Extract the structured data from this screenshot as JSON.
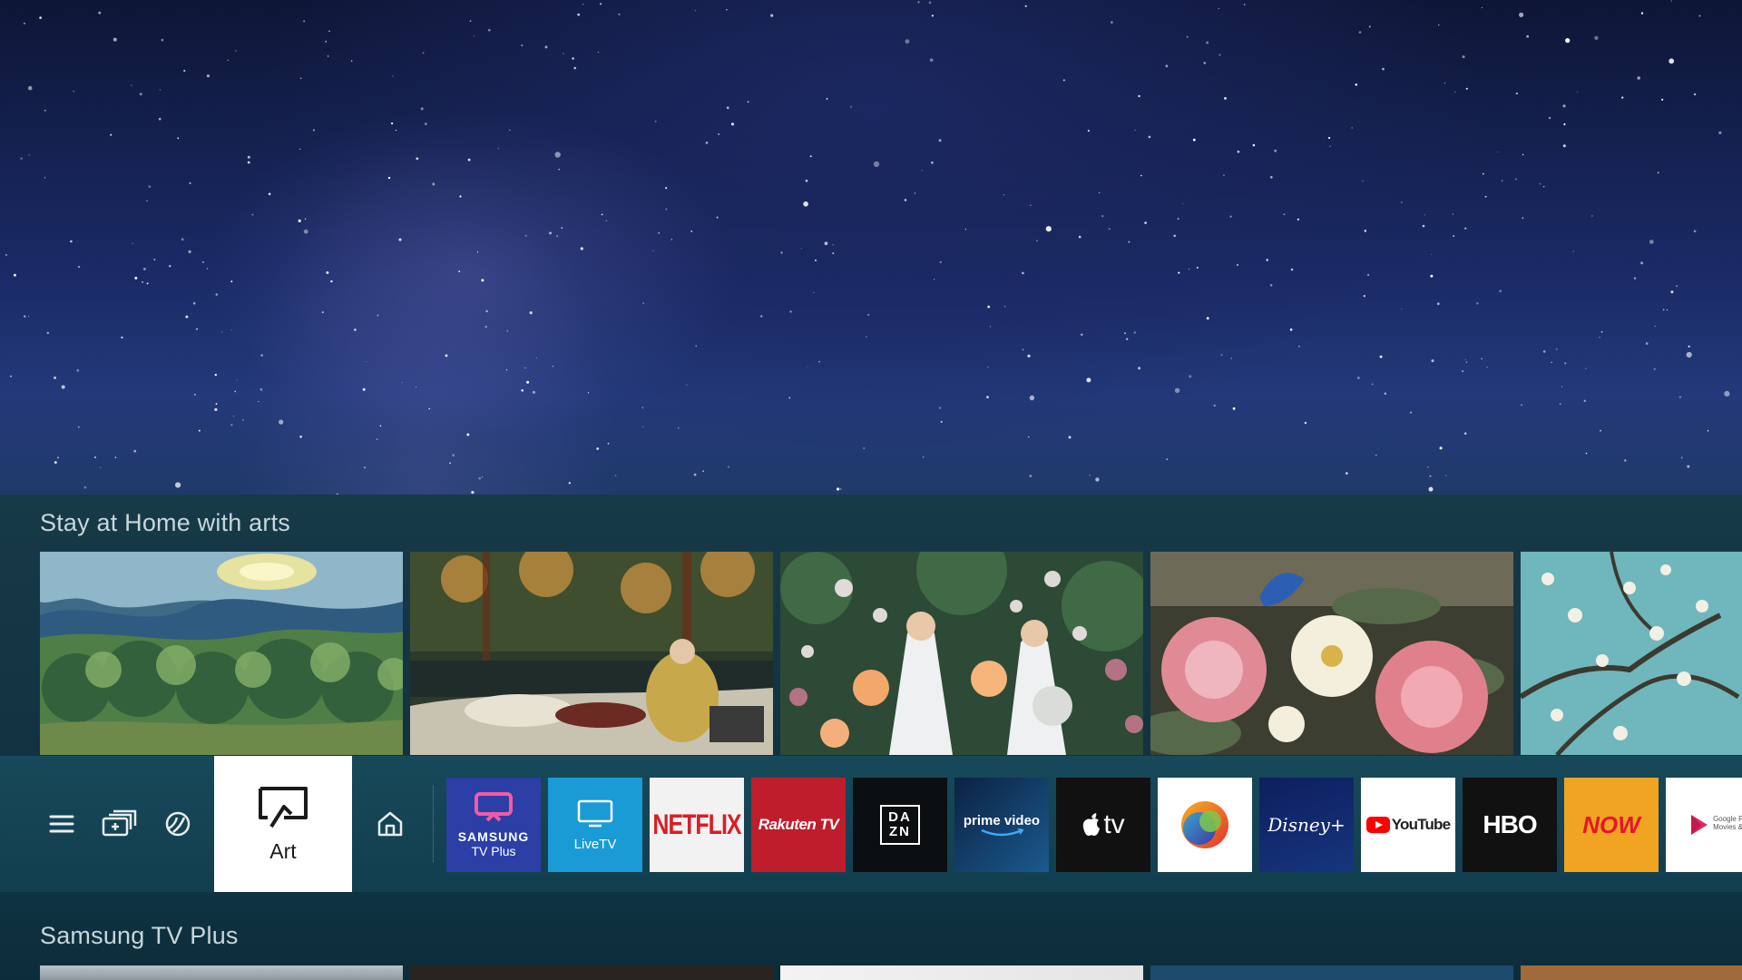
{
  "hero": {
    "caption": ""
  },
  "rows": [
    {
      "title": "Stay at Home with arts"
    },
    {
      "title": "Samsung TV Plus"
    }
  ],
  "art_tiles": [
    {
      "name": "olive-trees-painting"
    },
    {
      "name": "picnic-painting"
    },
    {
      "name": "lanterns-painting"
    },
    {
      "name": "flowers-still-life-painting"
    },
    {
      "name": "almond-blossom-painting"
    }
  ],
  "launcher": {
    "menu_icon": "menu-icon",
    "sources_icon": "sources-icon",
    "ambient_icon": "ambient-icon",
    "focused": {
      "label": "Art",
      "icon": "art-frame-icon"
    },
    "home_icon": "home-icon",
    "apps": [
      {
        "id": "samsung-tv-plus",
        "line1": "SAMSUNG",
        "line2": "TV Plus",
        "bg": "#2b3fa6"
      },
      {
        "id": "livetv",
        "label": "LiveTV",
        "bg": "#1b9bd6"
      },
      {
        "id": "netflix",
        "label": "NETFLIX",
        "bg": "#f2f2f2"
      },
      {
        "id": "rakuten-tv",
        "label": "Rakuten TV",
        "bg": "#bf1d2c"
      },
      {
        "id": "dazn",
        "line1": "DA",
        "line2": "ZN",
        "bg": "#0b0f12"
      },
      {
        "id": "prime-video",
        "label": "prime video",
        "bg": "#0f2f5c"
      },
      {
        "id": "apple-tv",
        "label": "tv",
        "bg": "#111111"
      },
      {
        "id": "discovery-plus",
        "label": "",
        "bg": "#ffffff"
      },
      {
        "id": "disney-plus",
        "label": "Disney+",
        "bg": "#0f2a74"
      },
      {
        "id": "youtube",
        "label": "YouTube",
        "bg": "#ffffff"
      },
      {
        "id": "hbo",
        "label": "HBO",
        "bg": "#111111"
      },
      {
        "id": "now",
        "label": "NOW",
        "bg": "#f0a422"
      },
      {
        "id": "google-play",
        "line1": "Google Pl",
        "line2": "Movies & T",
        "bg": "#ffffff"
      }
    ]
  },
  "colors": {
    "bar": "#17495a",
    "section": "#173a47",
    "focus": "#ffffff"
  }
}
